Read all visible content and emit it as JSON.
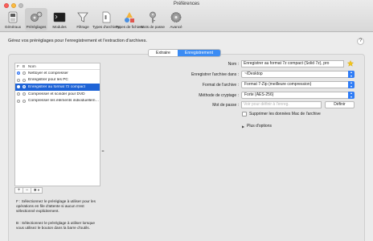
{
  "window": {
    "title": "Préférences"
  },
  "toolbar": {
    "items": [
      {
        "label": "Généraux",
        "icon": "switch-icon"
      },
      {
        "label": "Préréglages",
        "icon": "gears-icon",
        "active": true
      },
      {
        "label": "Modules",
        "icon": "terminal-icon"
      },
      {
        "label": "Filtrage",
        "icon": "funnel-icon"
      },
      {
        "label": "Types d'archives",
        "icon": "archive-doc-icon"
      },
      {
        "label": "Types de fichiers",
        "icon": "file-types-icon"
      },
      {
        "label": "Mots de passe",
        "icon": "key-icon"
      },
      {
        "label": "Avancé",
        "icon": "gear-icon"
      }
    ]
  },
  "header": {
    "text": "Gérez vos préréglages pour l'enregistrement et l'extraction d'archives.",
    "help": "?"
  },
  "tabs": [
    {
      "label": "Extraire"
    },
    {
      "label": "Enregistrement",
      "active": true
    }
  ],
  "presets": {
    "columns": {
      "f": "F",
      "b": "B",
      "name": "Nom"
    },
    "rows": [
      {
        "name": "Nettoyer et compresser",
        "f": true,
        "b": false
      },
      {
        "name": "Enregistrer pour les PC",
        "f": false,
        "b": false
      },
      {
        "name": "Enregistrer au format 7z compact",
        "f": false,
        "b": false,
        "selected": true
      },
      {
        "name": "Compresser et scinder pour DVD",
        "f": false,
        "b": false
      },
      {
        "name": "Compresser les éléments individuellement",
        "f": false,
        "b": false
      }
    ],
    "buttons": {
      "add": "+",
      "remove": "−",
      "action": "✱ ▾"
    }
  },
  "help_f": "F : Sélectionnez le préréglage à utiliser pour les opérations en file d'attente si aucun n'est sélectionné explicitement.",
  "help_b": "B : Sélectionnez le préréglage à utiliser lorsque vous utilisez le bouton dans la barre d'outils.",
  "form": {
    "name_label": "Nom :",
    "name_value": "Enregistrer au format 7z compact (Solid 7z), pro",
    "save_in_label": "Enregistrer l'archive dans :",
    "save_in_value": "~/Desktop",
    "format_label": "Format de l'archive :",
    "format_value": "Format 7-Zip (meilleure compression)",
    "encryption_label": "Méthode de cryptage :",
    "encryption_value": "Forte (AES-256)",
    "password_label": "Mot de passe :",
    "password_placeholder": "Voir pour définir à l'enreg.",
    "define_button": "Définir",
    "remove_mac_label": "Supprimer les données Mac de l'archive",
    "more_options": "Plus d'options"
  },
  "colors": {
    "accent": "#3b8cf4",
    "selection": "#1e63d6"
  }
}
